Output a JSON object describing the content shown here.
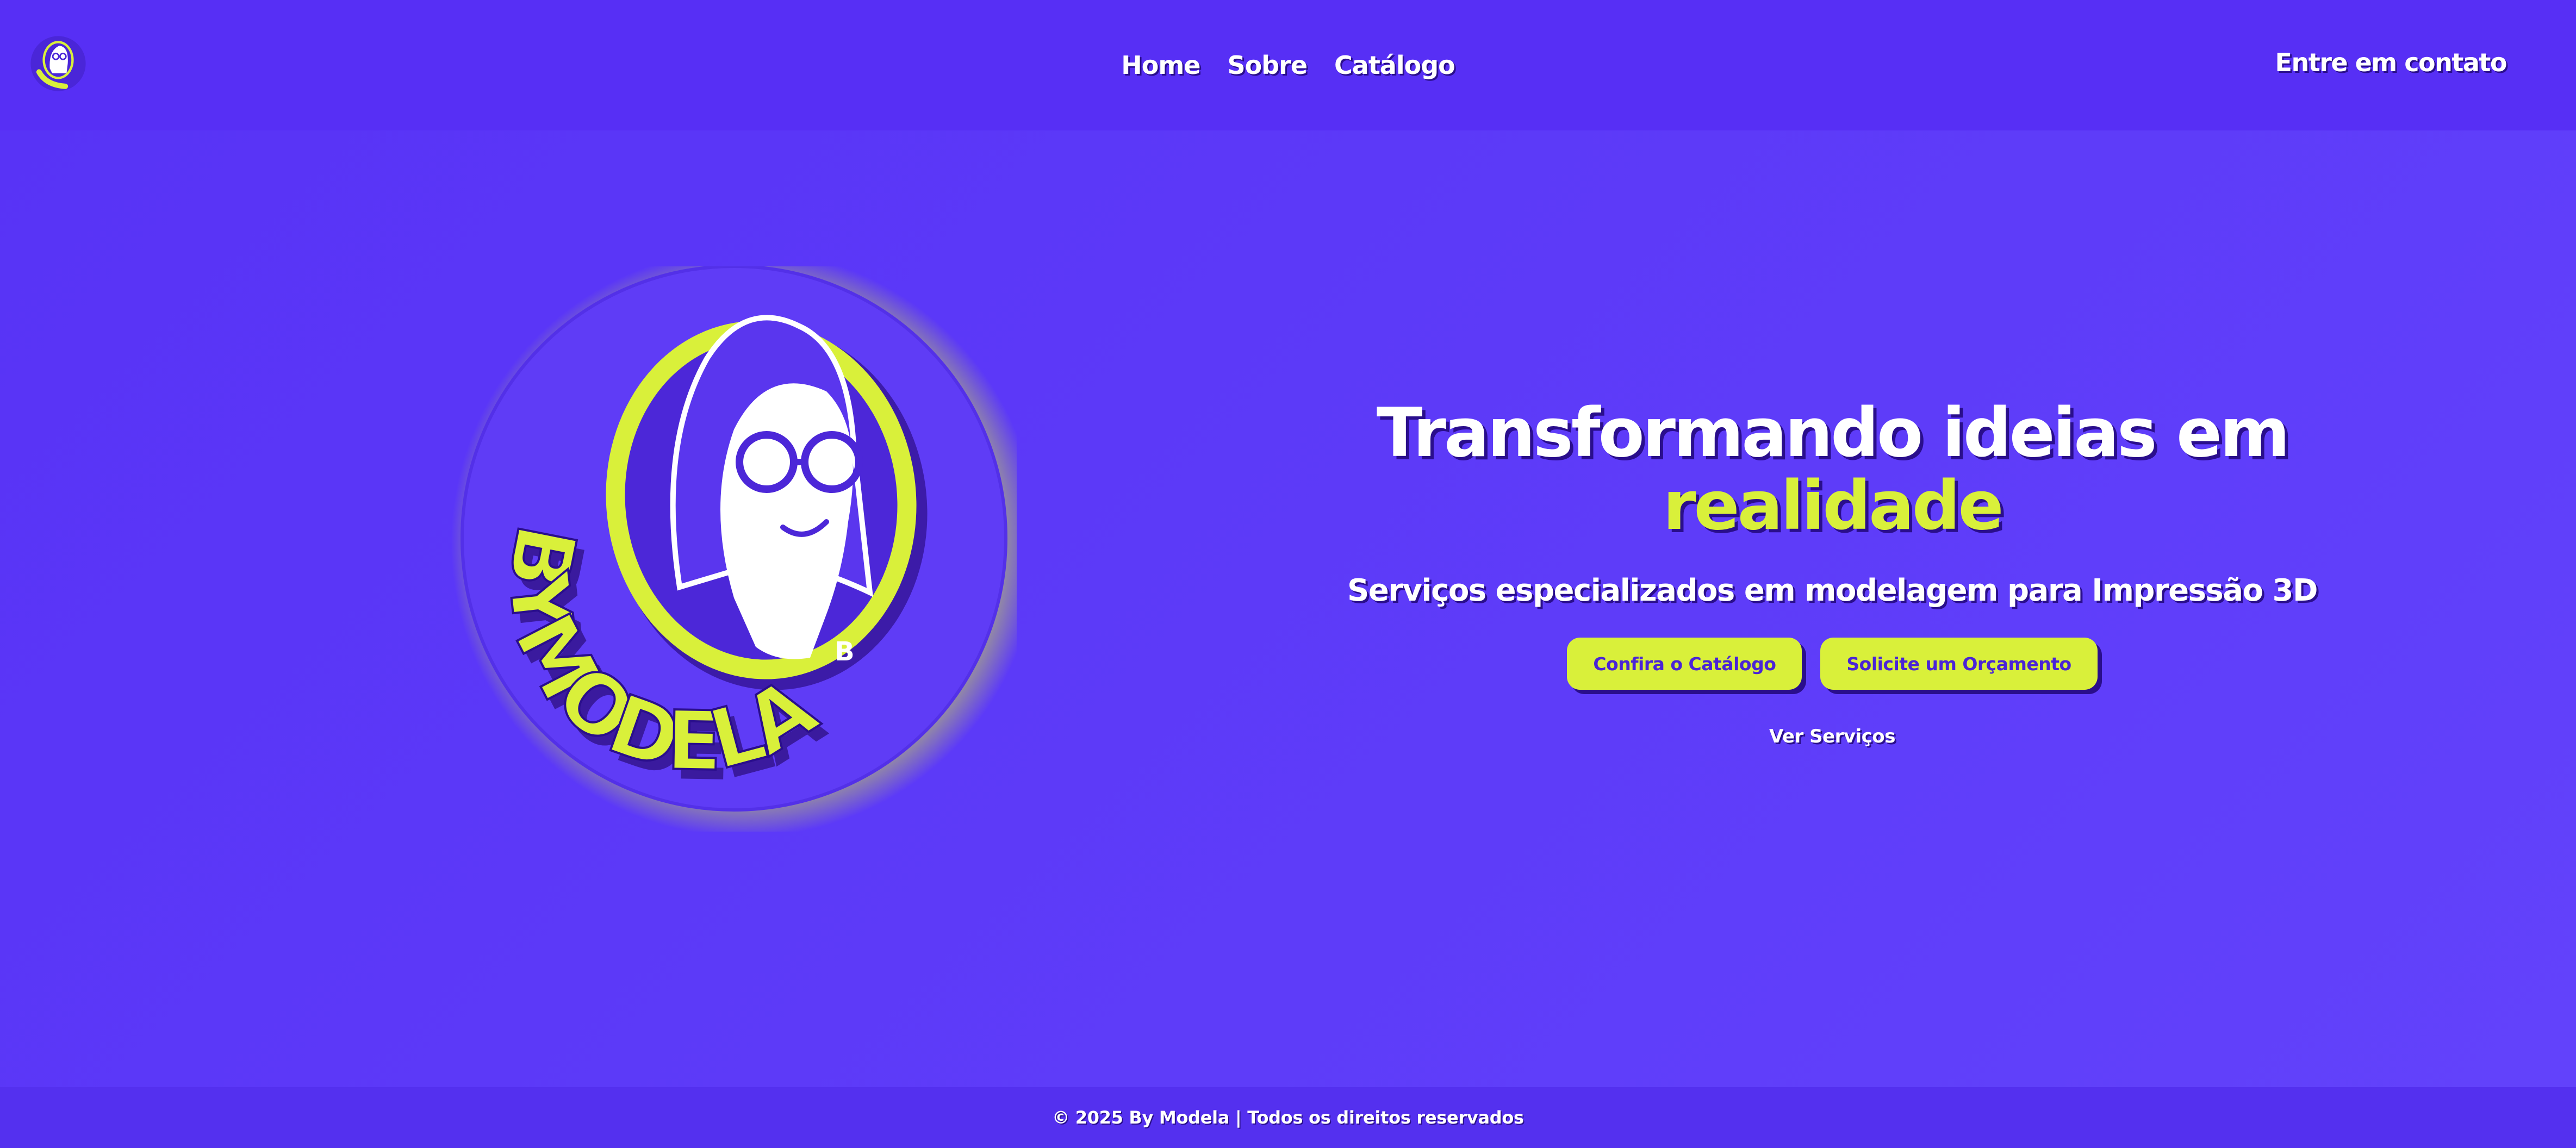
{
  "brand": {
    "name": "BYMODELA",
    "badge_letter": "B",
    "logo_icon": "bymodela-logo"
  },
  "nav": {
    "items": [
      {
        "label": "Home"
      },
      {
        "label": "Sobre"
      },
      {
        "label": "Catálogo"
      }
    ],
    "contact_label": "Entre em contato"
  },
  "hero": {
    "title_line1": "Transformando ideias em",
    "title_accent": "realidade",
    "subtitle": "Serviços especializados em modelagem para Impressão 3D",
    "primary_button": "Confira o Catálogo",
    "secondary_button": "Solicite um Orçamento",
    "services_link": "Ver Serviços"
  },
  "footer": {
    "text": "© 2025 By Modela | Todos os direitos reservados"
  },
  "colors": {
    "primary": "#5b35f8",
    "accent": "#d9f03a",
    "dark_shadow": "#2a0e8c",
    "text": "#ffffff"
  }
}
